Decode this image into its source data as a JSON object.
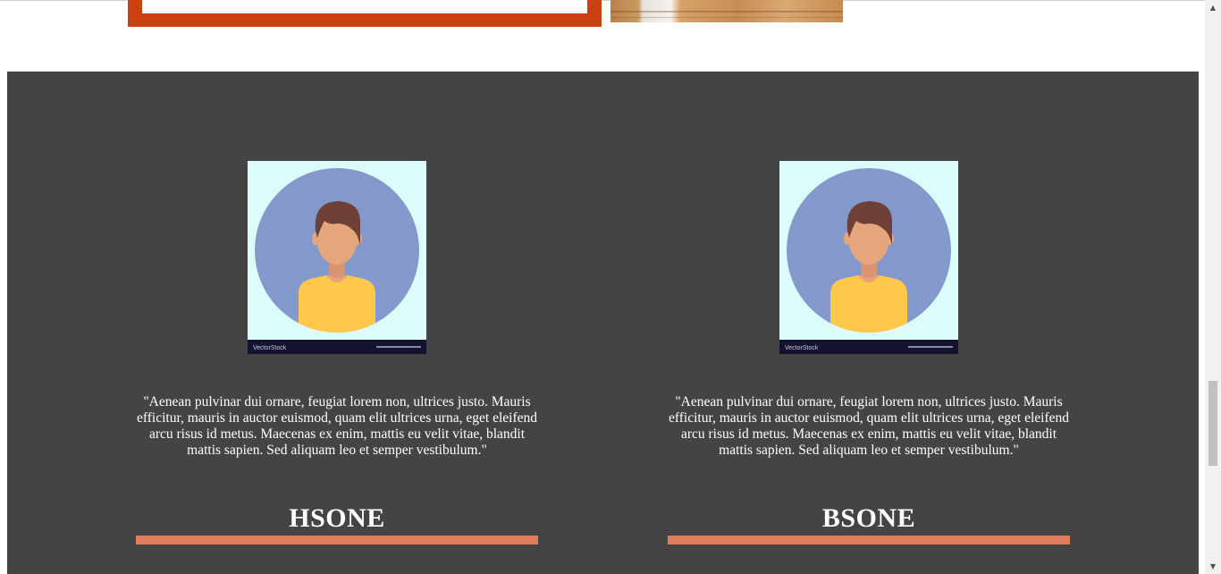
{
  "colors": {
    "accent_frame": "#cc4111",
    "section_bg": "#444444",
    "accent_underline": "#e07c59"
  },
  "testimonials": [
    {
      "avatar_watermark": "VectorStock",
      "quote": "\"Aenean pulvinar dui ornare, feugiat lorem non, ultrices justo. Mauris efficitur, mauris in auctor euismod, quam elit ultrices urna, eget eleifend arcu risus id metus. Maecenas ex enim, mattis eu velit vitae, blandit mattis sapien. Sed aliquam leo et semper vestibulum.\"",
      "name": "HSONE"
    },
    {
      "avatar_watermark": "VectorStock",
      "quote": "\"Aenean pulvinar dui ornare, feugiat lorem non, ultrices justo. Mauris efficitur, mauris in auctor euismod, quam elit ultrices urna, eget eleifend arcu risus id metus. Maecenas ex enim, mattis eu velit vitae, blandit mattis sapien. Sed aliquam leo et semper vestibulum.\"",
      "name": "BSONE"
    }
  ],
  "scrollbar": {
    "up_icon": "triangle-up-icon",
    "down_icon": "triangle-down-icon",
    "up_glyph": "▲",
    "down_glyph": "▼"
  }
}
